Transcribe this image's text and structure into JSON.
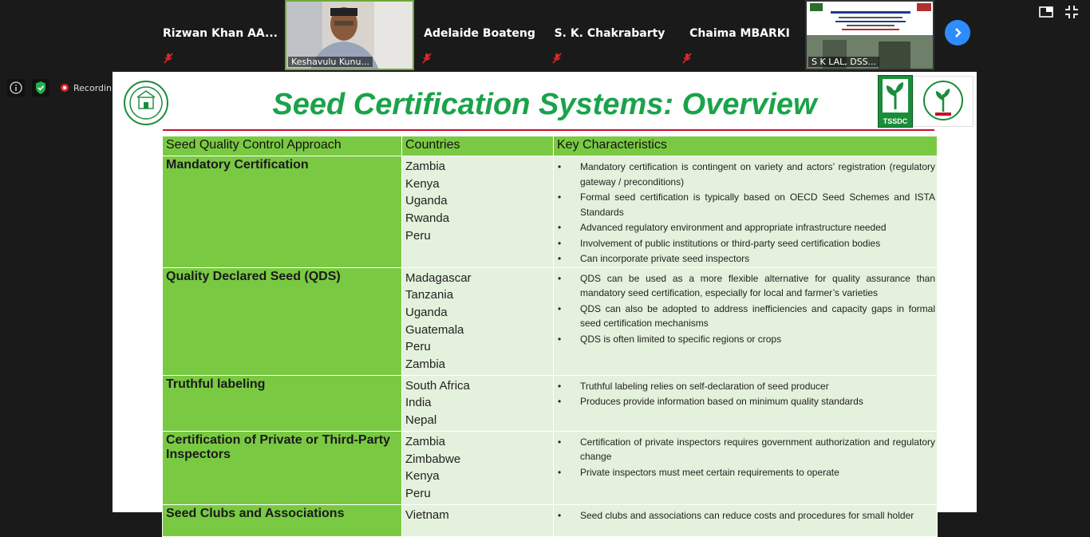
{
  "participants": [
    {
      "name": "Rizwan Khan AA...",
      "muted": true
    },
    {
      "name": "Keshavulu Kunu...",
      "video": true
    },
    {
      "name": "Adelaide Boateng",
      "muted": true
    },
    {
      "name": "S. K. Chakrabarty",
      "muted": true
    },
    {
      "name": "Chaima MBARKI",
      "muted": true
    },
    {
      "name": "S K LAL, DSS...",
      "video": true
    }
  ],
  "status": {
    "recording_label": "Recordin"
  },
  "slide": {
    "title": "Seed Certification Systems: Overview",
    "tssdc_logo_text": "TSSDC",
    "headers": [
      "Seed Quality Control Approach",
      "Countries",
      "Key Characteristics"
    ],
    "rows": [
      {
        "approach": "Mandatory Certification",
        "countries": [
          "Zambia",
          "Kenya",
          "Uganda",
          "Rwanda",
          "Peru"
        ],
        "characteristics": [
          "Mandatory certification is contingent on variety and actors’ registration (regulatory gateway / preconditions)",
          "Formal seed certification is typically based on OECD Seed Schemes and ISTA Standards",
          "Advanced regulatory environment and appropriate infrastructure needed",
          "Involvement of public institutions or third-party seed certification bodies",
          "Can incorporate private seed inspectors"
        ]
      },
      {
        "approach": "Quality Declared Seed (QDS)",
        "countries": [
          "Madagascar",
          "Tanzania",
          "Uganda",
          "Guatemala",
          "Peru",
          "Zambia"
        ],
        "characteristics": [
          "QDS can be used as a more flexible alternative for quality assurance than mandatory seed certification, especially for local and farmer’s varieties",
          "QDS can also be adopted to address inefficiencies and capacity gaps in formal seed certification mechanisms",
          "QDS is often limited to specific regions or crops"
        ]
      },
      {
        "approach": "Truthful labeling",
        "countries": [
          "South Africa",
          "India",
          "Nepal"
        ],
        "characteristics": [
          "Truthful labeling relies on self-declaration of seed producer",
          "Produces provide information based on minimum quality standards"
        ]
      },
      {
        "approach": "Certification of Private or Third-Party Inspectors",
        "countries": [
          "Zambia",
          "Zimbabwe",
          "Kenya",
          "Peru"
        ],
        "characteristics": [
          "Certification of private inspectors requires government authorization and regulatory change",
          "Private inspectors must meet certain requirements to operate"
        ]
      },
      {
        "approach": "Seed Clubs and Associations",
        "countries": [
          "Vietnam"
        ],
        "characteristics": [
          "Seed clubs and associations can reduce costs and procedures for small holder"
        ]
      }
    ]
  }
}
